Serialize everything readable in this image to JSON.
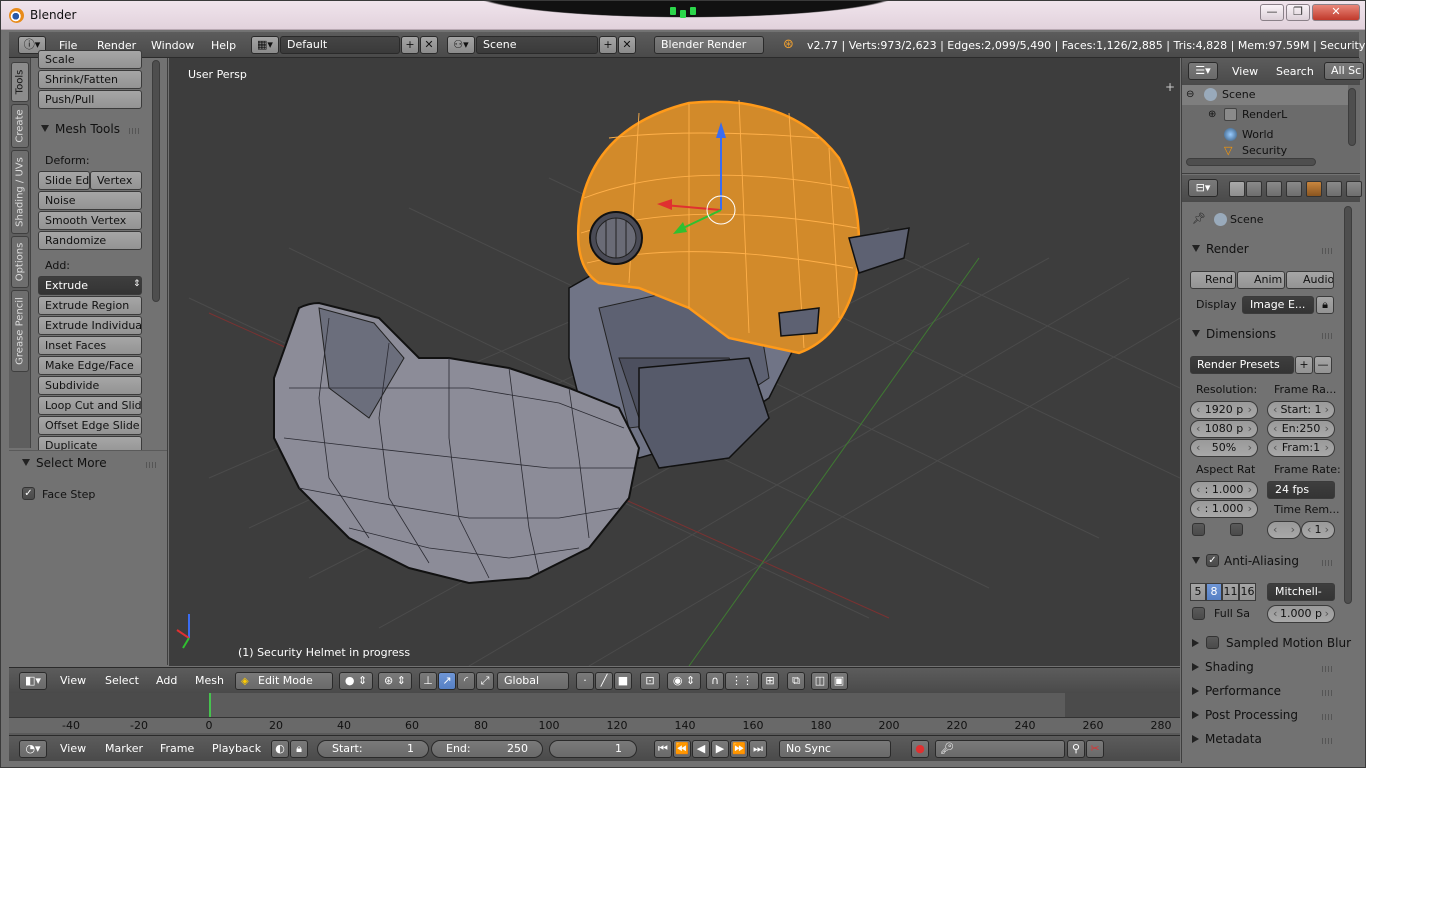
{
  "window": {
    "title": "Blender",
    "controls": [
      "—",
      "❐",
      "✕"
    ]
  },
  "topbar": {
    "menus": [
      "File",
      "Render",
      "Window",
      "Help"
    ],
    "layout_value": "Default",
    "scene_value": "Scene",
    "engine_value": "Blender Render",
    "info": "v2.77 | Verts:973/2,623 | Edges:2,099/5,490 | Faces:1,126/2,885 | Tris:4,828 | Mem:97.59M | Security Helm"
  },
  "toolshelf": {
    "tabs": [
      "Tools",
      "Create",
      "Shading / UVs",
      "Options",
      "Grease Pencil"
    ],
    "top_buttons": [
      "Scale",
      "Shrink/Fatten",
      "Push/Pull"
    ],
    "mesh_tools_title": "Mesh Tools",
    "deform_label": "Deform:",
    "slide_edge": "Slide Ed",
    "vertex": "Vertex",
    "deform_buttons": [
      "Noise",
      "Smooth Vertex",
      "Randomize"
    ],
    "add_label": "Add:",
    "extrude_value": "Extrude",
    "add_buttons": [
      "Extrude Region",
      "Extrude Individual",
      "Inset Faces",
      "Make Edge/Face",
      "Subdivide",
      "Loop Cut and Slide",
      "Offset Edge Slide",
      "Duplicate"
    ],
    "select_more_title": "Select More",
    "face_step_label": "Face Step"
  },
  "viewport": {
    "view_label": "User Persp",
    "object_label": "(1) Security Helmet in progress",
    "colors": {
      "background": "#3d3d3d",
      "selection": "#f29a1a",
      "mesh": "#8c8c98"
    }
  },
  "header3d": {
    "menus": [
      "View",
      "Select",
      "Add",
      "Mesh"
    ],
    "mode_value": "Edit Mode",
    "orientation_value": "Global"
  },
  "timeline": {
    "ticks": [
      "-40",
      "-20",
      "0",
      "20",
      "40",
      "60",
      "80",
      "100",
      "120",
      "140",
      "160",
      "180",
      "200",
      "220",
      "240",
      "260",
      "280"
    ],
    "menus": [
      "View",
      "Marker",
      "Frame",
      "Playback"
    ],
    "start_label": "Start:",
    "start_value": "1",
    "end_label": "End:",
    "end_value": "250",
    "current_frame": "1",
    "sync_value": "No Sync"
  },
  "outliner": {
    "header": {
      "view": "View",
      "search": "Search",
      "all_scenes": "All Sc"
    },
    "rows": [
      "Scene",
      "RenderL",
      "World",
      "Security"
    ]
  },
  "properties": {
    "context": "Scene",
    "render": {
      "title": "Render",
      "buttons": [
        "Rend",
        "Anim",
        "Audio"
      ],
      "display_label": "Display",
      "display_value": "Image E..."
    },
    "dimensions": {
      "title": "Dimensions",
      "presets": "Render Presets",
      "resolution_label": "Resolution:",
      "res_x": "1920 p",
      "res_y": "1080 p",
      "res_pct": "50%",
      "frame_range_label": "Frame Ra...",
      "frame_start": "Start: 1",
      "frame_end": "En:250",
      "frame_step": "Fram:1",
      "aspect_label": "Aspect Rat",
      "aspect_x": ": 1.000",
      "aspect_y": ": 1.000",
      "frame_rate_label": "Frame Rate:",
      "fps_value": "24 fps",
      "time_remap_label": "Time Rem...",
      "time_remap_value": "1"
    },
    "anti_aliasing": {
      "title": "Anti-Aliasing",
      "samples": [
        "5",
        "8",
        "11",
        "16"
      ],
      "selected_sample": "8",
      "filter_value": "Mitchell-",
      "full_sample_label": "Full Sa",
      "filter_size": "1.000 p"
    },
    "collapsed_panels": [
      "Sampled Motion Blur",
      "Shading",
      "Performance",
      "Post Processing",
      "Metadata"
    ]
  }
}
